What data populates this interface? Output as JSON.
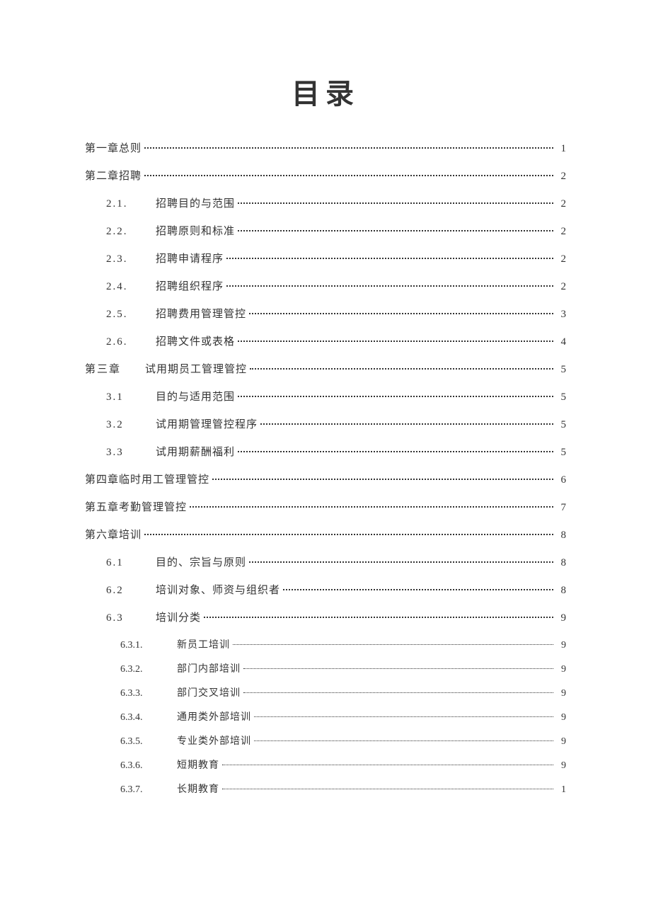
{
  "title": "目录",
  "entries": [
    {
      "level": 0,
      "num": "",
      "text": "第一章总则",
      "page": "1"
    },
    {
      "level": 0,
      "num": "",
      "text": "第二章招聘",
      "page": "2"
    },
    {
      "level": 1,
      "num": "2.1.",
      "text": "招聘目的与范围",
      "page": "2"
    },
    {
      "level": 1,
      "num": "2.2.",
      "text": "招聘原则和标准",
      "page": "2"
    },
    {
      "level": 1,
      "num": "2.3.",
      "text": "招聘申请程序",
      "page": "2"
    },
    {
      "level": 1,
      "num": "2.4.",
      "text": "招聘组织程序",
      "page": "2"
    },
    {
      "level": 1,
      "num": "2.5.",
      "text": "招聘费用管理管控",
      "page": "3"
    },
    {
      "level": 1,
      "num": "2.6.",
      "text": "招聘文件或表格",
      "page": "4"
    },
    {
      "level": 1,
      "num": "第三章",
      "text": "试用期员工管理管控",
      "page": "5",
      "special": true
    },
    {
      "level": 1,
      "num": "3.1",
      "text": "目的与适用范围",
      "page": "5"
    },
    {
      "level": 1,
      "num": "3.2",
      "text": "试用期管理管控程序",
      "page": "5"
    },
    {
      "level": 1,
      "num": "3.3",
      "text": "试用期薪酬福利",
      "page": "5"
    },
    {
      "level": 0,
      "num": "",
      "text": "第四章临时用工管理管控",
      "page": "6"
    },
    {
      "level": 0,
      "num": "",
      "text": "第五章考勤管理管控",
      "page": "7"
    },
    {
      "level": 0,
      "num": "",
      "text": "第六章培训",
      "page": "8"
    },
    {
      "level": 1,
      "num": "6.1",
      "text": "目的、宗旨与原则",
      "page": "8"
    },
    {
      "level": 1,
      "num": "6.2",
      "text": "培训对象、师资与组织者",
      "page": "8"
    },
    {
      "level": 1,
      "num": "6.3",
      "text": "培训分类",
      "page": "9"
    },
    {
      "level": 2,
      "num": "6.3.1.",
      "text": "新员工培训",
      "page": "9"
    },
    {
      "level": 2,
      "num": "6.3.2.",
      "text": "部门内部培训",
      "page": "9"
    },
    {
      "level": 2,
      "num": "6.3.3.",
      "text": "部门交叉培训",
      "page": "9"
    },
    {
      "level": 2,
      "num": "6.3.4.",
      "text": "通用类外部培训",
      "page": "9"
    },
    {
      "level": 2,
      "num": "6.3.5.",
      "text": "专业类外部培训",
      "page": "9"
    },
    {
      "level": 2,
      "num": "6.3.6.",
      "text": "短期教育",
      "page": "9"
    },
    {
      "level": 2,
      "num": "6.3.7.",
      "text": "长期教育",
      "page": "1"
    }
  ]
}
